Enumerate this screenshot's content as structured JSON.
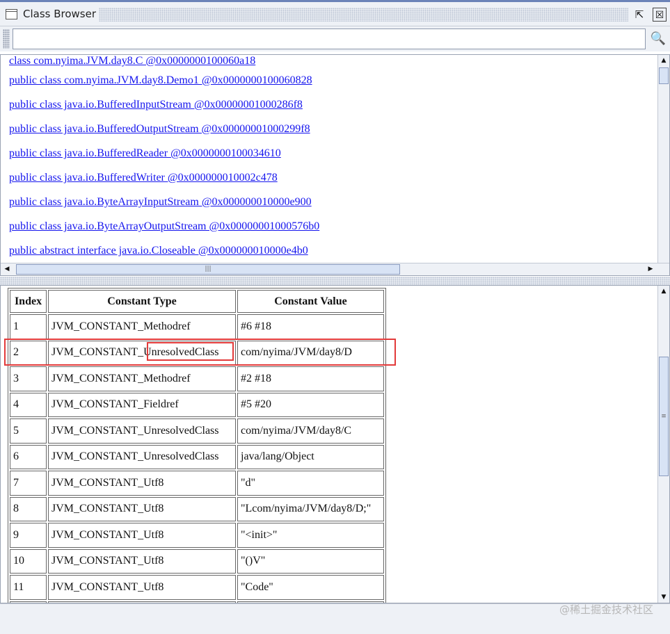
{
  "window": {
    "title": "Class Browser",
    "restore_glyph": "⇱",
    "close_glyph": "☒"
  },
  "search": {
    "value": "",
    "placeholder": "",
    "find_glyph": "🔍"
  },
  "class_list": [
    "class com.nyima.JVM.day8.C @0x0000000100060a18",
    "public class com.nyima.JVM.day8.Demo1 @0x0000000100060828",
    "public class java.io.BufferedInputStream @0x00000001000286f8",
    "public class java.io.BufferedOutputStream @0x00000001000299f8",
    "public class java.io.BufferedReader @0x0000000100034610",
    "public class java.io.BufferedWriter @0x000000010002c478",
    "public class java.io.ByteArrayInputStream @0x000000010000e900",
    "public class java.io.ByteArrayOutputStream @0x00000001000576b0",
    "public abstract interface java.io.Closeable @0x000000010000e4b0"
  ],
  "constant_pool": {
    "headers": [
      "Index",
      "Constant Type",
      "Constant Value"
    ],
    "rows": [
      [
        "1",
        "JVM_CONSTANT_Methodref",
        "#6 #18"
      ],
      [
        "2",
        "JVM_CONSTANT_",
        "UnresolvedClass",
        "com/nyima/JVM/day8/D"
      ],
      [
        "3",
        "JVM_CONSTANT_Methodref",
        "#2 #18"
      ],
      [
        "4",
        "JVM_CONSTANT_Fieldref",
        "#5 #20"
      ],
      [
        "5",
        "JVM_CONSTANT_UnresolvedClass",
        "com/nyima/JVM/day8/C"
      ],
      [
        "6",
        "JVM_CONSTANT_UnresolvedClass",
        "java/lang/Object"
      ],
      [
        "7",
        "JVM_CONSTANT_Utf8",
        "\"d\""
      ],
      [
        "8",
        "JVM_CONSTANT_Utf8",
        "\"Lcom/nyima/JVM/day8/D;\""
      ],
      [
        "9",
        "JVM_CONSTANT_Utf8",
        "\"<init>\""
      ],
      [
        "10",
        "JVM_CONSTANT_Utf8",
        "\"()V\""
      ],
      [
        "11",
        "JVM_CONSTANT_Utf8",
        "\"Code\""
      ]
    ]
  },
  "watermark": "@稀土掘金技术社区",
  "colors": {
    "link": "#1515ee",
    "highlight": "#e23a3a"
  }
}
